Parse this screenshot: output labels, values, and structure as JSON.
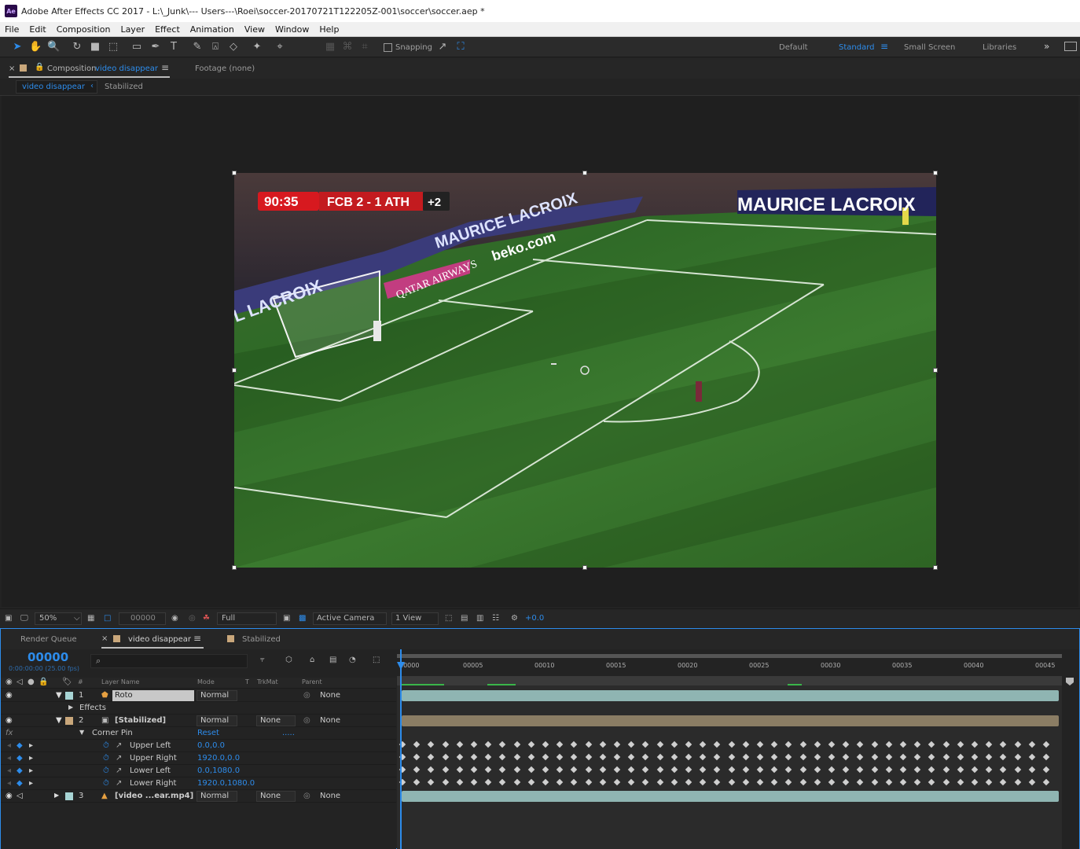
{
  "window": {
    "title": "Adobe After Effects CC 2017 - L:\\_Junk\\--- Users---\\Roei\\soccer-20170721T122205Z-001\\soccer\\soccer.aep *",
    "logo": "Ae"
  },
  "menu": [
    "File",
    "Edit",
    "Composition",
    "Layer",
    "Effect",
    "Animation",
    "View",
    "Window",
    "Help"
  ],
  "toolbar": {
    "snapping_label": "Snapping",
    "snapping_checked": false
  },
  "workspaces": {
    "default": "Default",
    "standard": "Standard",
    "small_screen": "Small Screen",
    "libraries": "Libraries"
  },
  "comp_panel": {
    "tab_prefix": "Composition",
    "tab_name": "video disappear",
    "footage_tab": "Footage (none)",
    "breadcrumb_active": "video disappear",
    "breadcrumb_next": "Stabilized"
  },
  "video_overlay": {
    "time": "90:35",
    "score": "FCB 2 - 1 ATH",
    "extra": "+2",
    "ad1": "MAURICE LACROIX",
    "ad2": "beko.com",
    "ad3": "QATAR AIRWAYS",
    "ad4": "MAURICE LACROIX",
    "ad5": "L LACROIX"
  },
  "viewer_footer": {
    "zoom": "50%",
    "timecode": "00000",
    "resolution": "Full",
    "camera": "Active Camera",
    "views": "1 View",
    "exposure": "+0.0"
  },
  "timeline": {
    "tab_render_queue": "Render Queue",
    "tab_active": "video disappear",
    "tab_other": "Stabilized",
    "current_time": "00000",
    "fps_info": "0:00:00:00 (25.00 fps)",
    "search_placeholder": "",
    "headers": {
      "num": "#",
      "layer_name": "Layer Name",
      "mode": "Mode",
      "t": "T",
      "trkmat": "TrkMat",
      "parent": "Parent"
    },
    "ruler": [
      "00000",
      "00005",
      "00010",
      "00015",
      "00020",
      "00025",
      "00030",
      "00035",
      "00040",
      "00045"
    ],
    "layers": [
      {
        "num": "1",
        "name": "Roto",
        "mode": "Normal",
        "trkmat": "",
        "parent": "None",
        "label_color": "#a7d4d4",
        "bar_color": "#8fb5b2"
      },
      {
        "num": "",
        "name": "Effects",
        "indent": true
      },
      {
        "num": "2",
        "name": "[Stabilized]",
        "mode": "Normal",
        "trkmat": "None",
        "parent": "None",
        "label_color": "#c9a77b",
        "bar_color": "#8b7d64"
      },
      {
        "num": "",
        "name": "Corner Pin",
        "reset": "Reset",
        "dots": "....."
      },
      {
        "prop": "Upper Left",
        "value": "0.0,0.0"
      },
      {
        "prop": "Upper Right",
        "value": "1920.0,0.0"
      },
      {
        "prop": "Lower Left",
        "value": "0.0,1080.0"
      },
      {
        "prop": "Lower Right",
        "value": "1920.0,1080.0"
      },
      {
        "num": "3",
        "name": "[video ...ear.mp4]",
        "mode": "Normal",
        "trkmat": "None",
        "parent": "None",
        "label_color": "#a7d4d4",
        "bar_color": "#8fb5b2"
      }
    ]
  }
}
